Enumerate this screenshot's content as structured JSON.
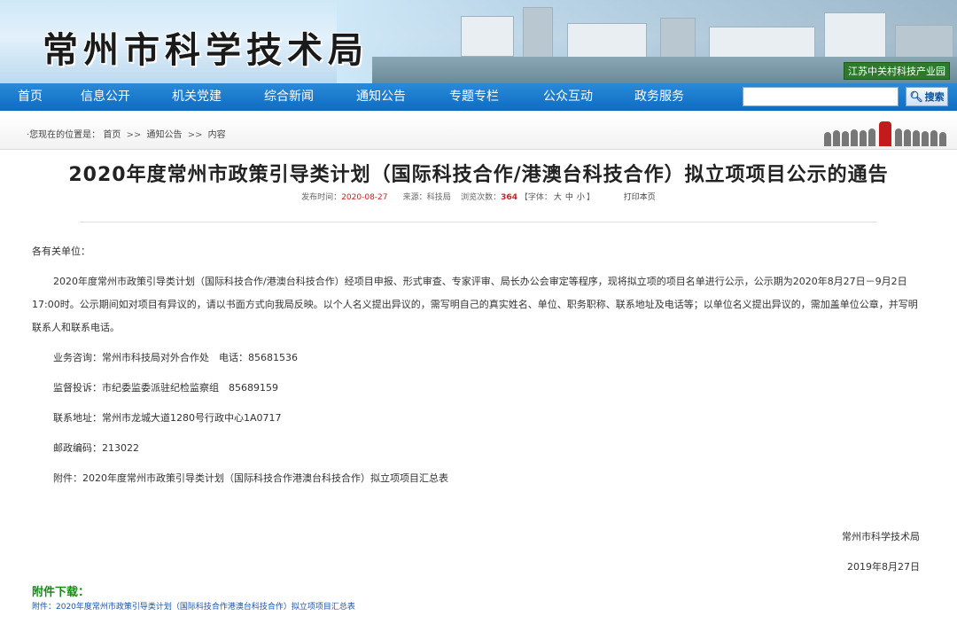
{
  "banner": {
    "site_title": "常州市科学技术局",
    "tag": "江苏中关村科技产业园"
  },
  "nav": {
    "items": [
      "首页",
      "信息公开",
      "机关党建",
      "综合新闻",
      "通知公告",
      "专题专栏",
      "公众互动",
      "政务服务"
    ],
    "search_placeholder": "",
    "search_label": "搜索"
  },
  "breadcrumb": {
    "prefix": "·您现在的位置是：",
    "items": [
      "首页",
      "通知公告",
      "内容"
    ],
    "separator": ">>"
  },
  "article": {
    "title": "2020年度常州市政策引导类计划（国际科技合作/港澳台科技合作）拟立项项目公示的通告",
    "meta": {
      "date_label": "发布时间：",
      "date": "2020-08-27",
      "source_label": "来源：",
      "source": "科技局",
      "hits_label": "浏览次数：",
      "hits": "364",
      "font_label": "【字体：",
      "font_sizes": [
        "大",
        "中",
        "小"
      ],
      "font_end": "】",
      "print_label": "打印本页"
    },
    "greeting": "各有关单位：",
    "paragraph": "2020年度常州市政策引导类计划（国际科技合作/港澳台科技合作）经项目申报、形式审查、专家评审、局长办公会审定等程序，现将拟立项的项目名单进行公示，公示期为2020年8月27日－9月2日17:00时。公示期间如对项目有异议的，请以书面方式向我局反映。以个人名义提出异议的，需写明自己的真实姓名、单位、职务职称、联系地址及电话等；以单位名义提出异议的，需加盖单位公章，并写明联系人和联系电话。",
    "contacts": [
      "业务咨询：常州市科技局对外合作处　电话：85681536",
      "监督投诉：市纪委监委派驻纪检监察组　85689159",
      "联系地址：常州市龙城大道1280号行政中心1A0717",
      "邮政编码：213022",
      "附件：2020年度常州市政策引导类计划（国际科技合作港澳台科技合作）拟立项项目汇总表"
    ],
    "signature": "常州市科学技术局",
    "signature_date": "2019年8月27日"
  },
  "downloads": {
    "title": "附件下载：",
    "link": "附件：2020年度常州市政策引导类计划（国际科技合作港澳台科技合作）拟立项项目汇总表"
  },
  "colors": {
    "nav_bg": "#0e6cc2",
    "date_red": "#d02020",
    "download_green": "#1a8a1a",
    "link_blue": "#1a55aa"
  }
}
